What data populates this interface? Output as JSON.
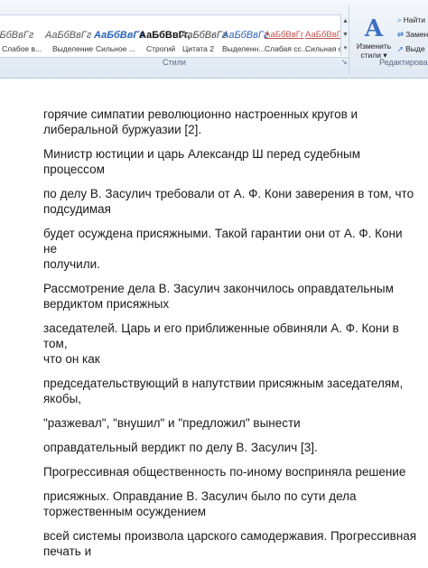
{
  "ribbon": {
    "styles_group_label": "Стили",
    "editing_group_label": "Редактирован",
    "styles": [
      {
        "sample": "АаБбВвГг",
        "caption": "Слабое в...",
        "color": "#555555",
        "italic": true,
        "bold": false
      },
      {
        "sample": "АаБбВвГг",
        "caption": "Выделение",
        "color": "#555555",
        "italic": true,
        "bold": false
      },
      {
        "sample": "АаБбВвГг",
        "caption": "Сильное ...",
        "color": "#2a62b8",
        "italic": true,
        "bold": true
      },
      {
        "sample": "АаБбВвГг,",
        "caption": "Строгий",
        "color": "#111111",
        "italic": false,
        "bold": true
      },
      {
        "sample": "АаБбВвГг",
        "caption": "Цитата 2",
        "color": "#444444",
        "italic": true,
        "bold": false
      },
      {
        "sample": "АаБбВвГг",
        "caption": "Выделенн...",
        "color": "#2a62b8",
        "italic": true,
        "bold": false
      },
      {
        "sample": "АаБбВвГг",
        "caption": "Слабая сс...",
        "color": "#c0504d",
        "italic": false,
        "bold": false
      },
      {
        "sample": "АаБбВвГг",
        "caption": "Сильная с...",
        "color": "#c0504d",
        "italic": false,
        "bold": false
      }
    ],
    "change_styles_label_1": "Изменить",
    "change_styles_label_2": "стили",
    "find_label": "Найти",
    "replace_label": "Замен",
    "select_label": "Выде"
  },
  "document": {
    "paragraphs": [
      [
        "горячие симпатии революционно  настроенных кругов и",
        "либеральной буржуазии [2]."
      ],
      [
        "Министр юстиции и царь Александр Ш перед судебным процессом"
      ],
      [
        "по делу В. Засулич требовали  от А. Ф. Кони заверения  в том, что",
        "подсудимая"
      ],
      [
        "будет осуждена присяжными. Такой гарантии они от А. Ф. Кони не",
        "получили."
      ],
      [
        "Рассмотрение дела В. Засулич закончилось оправдательным",
        "вердиктом присяжных"
      ],
      [
        "заседателей. Царь и его приближенные обвиняли А. Ф. Кони в том,",
        "что он как"
      ],
      [
        "председательствующий  в напутствии присяжным заседателям,",
        "якобы,"
      ],
      [
        "\"разжевал\", \"внушил\" и \"предложил\" вынести"
      ],
      [
        "оправдательный вердикт по делу В. Засулич [3]."
      ],
      [
        "Прогрессивная общественность  по-иному восприняла решение"
      ],
      [
        "присяжных. Оправдание В. Засулич было по сути дела",
        "торжественным  осуждением"
      ],
      [
        "всей системы произвола царского самодержавия. Прогрессивная",
        "печать и"
      ]
    ]
  }
}
